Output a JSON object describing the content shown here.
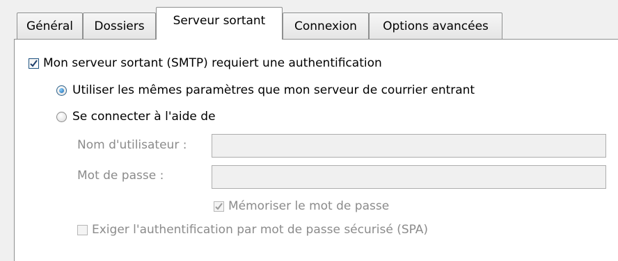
{
  "tabs": [
    {
      "label": "Général"
    },
    {
      "label": "Dossiers"
    },
    {
      "label": "Serveur sortant"
    },
    {
      "label": "Connexion"
    },
    {
      "label": "Options avancées"
    }
  ],
  "active_tab": "Serveur sortant",
  "auth": {
    "requires_auth_label": "Mon serveur sortant (SMTP) requiert une authentification",
    "requires_auth_checked": true,
    "use_same_settings_label": "Utiliser les mêmes paramètres que mon serveur de courrier entrant",
    "use_same_settings_selected": true,
    "connect_with_label": "Se connecter à l'aide de",
    "connect_with_selected": false
  },
  "credentials": {
    "username_label": "Nom d'utilisateur :",
    "username_value": "",
    "password_label": "Mot de passe :",
    "password_value": "",
    "remember_password_label": "Mémoriser le mot de passe",
    "remember_password_checked": true,
    "spa_label": "Exiger l'authentification par mot de passe sécurisé (SPA)",
    "spa_checked": false
  }
}
